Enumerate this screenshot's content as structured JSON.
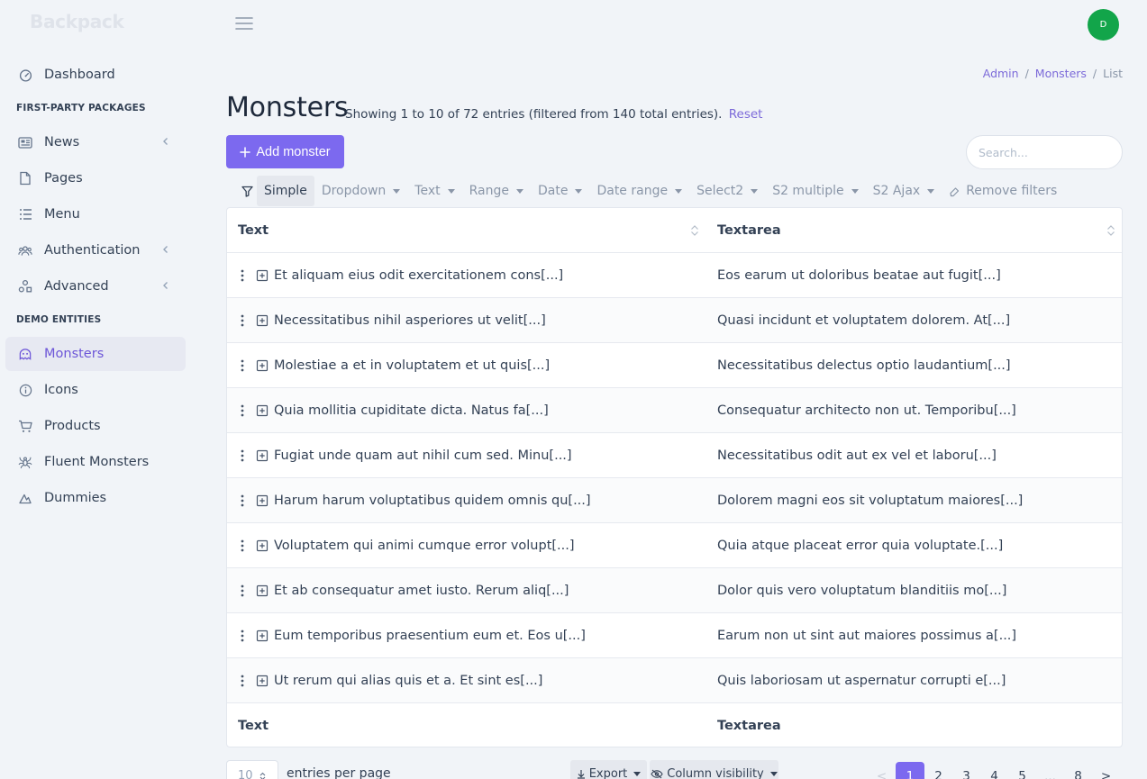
{
  "brand": "Backpack",
  "header": {
    "avatar_initial": "D"
  },
  "sidebar": {
    "items_top": [
      {
        "label": "Dashboard",
        "icon": "gauge-icon"
      }
    ],
    "section1": "FIRST-PARTY PACKAGES",
    "items_section1": [
      {
        "label": "News",
        "icon": "newspaper-icon",
        "has_children": true
      },
      {
        "label": "Pages",
        "icon": "file-icon",
        "has_children": false
      },
      {
        "label": "Menu",
        "icon": "list-icon",
        "has_children": false
      },
      {
        "label": "Authentication",
        "icon": "users-icon",
        "has_children": true
      },
      {
        "label": "Advanced",
        "icon": "shapes-icon",
        "has_children": true
      }
    ],
    "section2": "DEMO ENTITIES",
    "items_section2": [
      {
        "label": "Monsters",
        "icon": "ghost-icon",
        "active": true
      },
      {
        "label": "Icons",
        "icon": "info-circle-icon"
      },
      {
        "label": "Products",
        "icon": "cart-icon"
      },
      {
        "label": "Fluent Monsters",
        "icon": "spider-icon"
      },
      {
        "label": "Dummies",
        "icon": "cloud-icon"
      }
    ]
  },
  "breadcrumb": {
    "admin": "Admin",
    "monsters": "Monsters",
    "current": "List",
    "sep": "/"
  },
  "page": {
    "title": "Monsters",
    "subtitle": "Showing 1 to 10 of 72 entries (filtered from 140 total entries).",
    "reset": "Reset",
    "add_button": "Add monster",
    "search_placeholder": "Search..."
  },
  "filters": {
    "items": [
      "Simple",
      "Dropdown",
      "Text",
      "Range",
      "Date",
      "Date range",
      "Select2",
      "S2 multiple",
      "S2 Ajax"
    ],
    "active": "Simple",
    "remove": "Remove filters"
  },
  "table": {
    "columns": [
      "Text",
      "Textarea"
    ],
    "rows": [
      [
        "Et aliquam eius odit exercitationem cons[...]",
        "Eos earum ut doloribus beatae aut fugit[...]"
      ],
      [
        "Necessitatibus nihil asperiores ut velit[...]",
        "Quasi incidunt et voluptatem dolorem. At[...]"
      ],
      [
        "Molestiae a et in voluptatem et ut quis[...]",
        "Necessitatibus delectus optio laudantium[...]"
      ],
      [
        "Quia mollitia cupiditate dicta. Natus fa[...]",
        "Consequatur architecto non ut. Temporibu[...]"
      ],
      [
        "Fugiat unde quam aut nihil cum sed. Minu[...]",
        "Necessitatibus odit aut ex vel et laboru[...]"
      ],
      [
        "Harum harum voluptatibus quidem omnis qu[...]",
        "Dolorem magni eos sit voluptatum maiores[...]"
      ],
      [
        "Voluptatem qui animi cumque error volupt[...]",
        "Quia atque placeat error quia voluptate.[...]"
      ],
      [
        "Et ab consequatur amet iusto. Rerum aliq[...]",
        "Dolor quis vero voluptatum blanditiis mo[...]"
      ],
      [
        "Eum temporibus praesentium eum et. Eos u[...]",
        "Earum non ut sint aut maiores possimus a[...]"
      ],
      [
        "Ut rerum qui alias quis et a. Et sint es[...]",
        "Quis laboriosam ut aspernatur corrupti e[...]"
      ]
    ]
  },
  "footer": {
    "per_page_value": "10",
    "per_page_label": "entries per page",
    "export": "Export",
    "column_visibility": "Column visibility",
    "pages": [
      "<",
      "1",
      "2",
      "3",
      "4",
      "5",
      "...",
      "8",
      ">"
    ],
    "current_page": "1"
  },
  "colors": {
    "accent": "#7c69ef",
    "avatar": "#12a54a",
    "link": "#7c6ad9"
  }
}
